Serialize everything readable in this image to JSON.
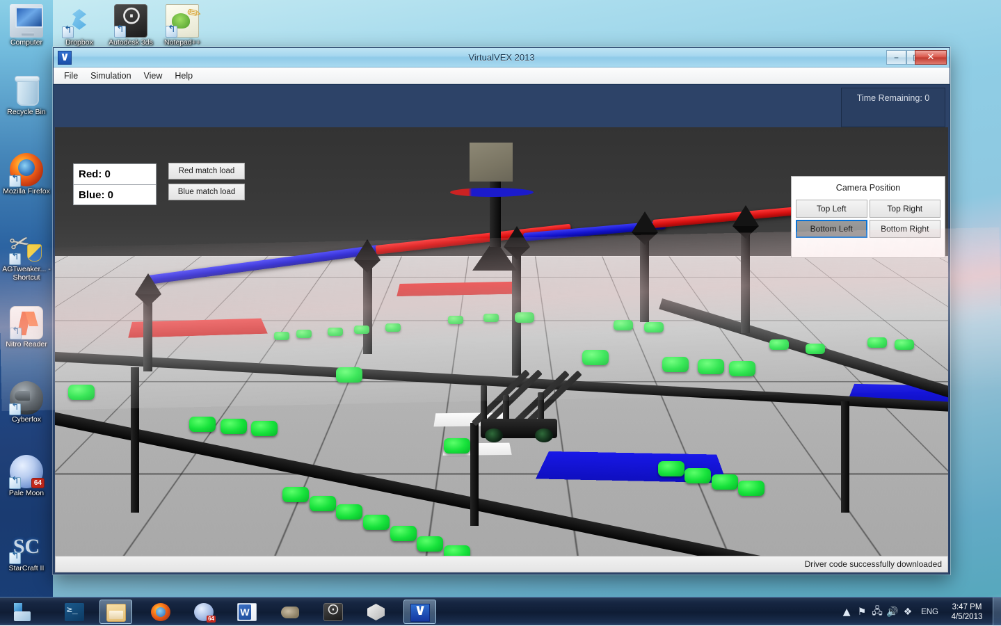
{
  "desktop": {
    "icons_left": [
      {
        "label": "Computer",
        "icon": "computer-icon"
      },
      {
        "label": "Recycle Bin",
        "icon": "recycle-bin-icon"
      },
      {
        "label": "Mozilla Firefox",
        "icon": "firefox-icon"
      },
      {
        "label": "AGTweaker... - Shortcut",
        "icon": "agtweaker-icon"
      },
      {
        "label": "Nitro Reader",
        "icon": "nitro-reader-icon"
      },
      {
        "label": "Cyberfox",
        "icon": "cyberfox-icon"
      },
      {
        "label": "Pale Moon",
        "icon": "pale-moon-icon",
        "badge": "64"
      },
      {
        "label": "StarCraft II",
        "icon": "starcraft-icon"
      }
    ],
    "icons_top": [
      {
        "label": "Dropbox",
        "icon": "dropbox-icon"
      },
      {
        "label": "Autodesk 3ds",
        "icon": "autodesk-3ds-icon"
      },
      {
        "label": "Notepad++",
        "icon": "notepad-plus-plus-icon"
      }
    ]
  },
  "window": {
    "title": "VirtualVEX 2013",
    "app_icon": "virtualvex-icon",
    "controls": {
      "minimize": "–",
      "maximize": "□",
      "close": "✕"
    },
    "menu": [
      "File",
      "Simulation",
      "View",
      "Help"
    ],
    "status": "Driver code successfully downloaded"
  },
  "hud": {
    "time_remaining": "Time Remaining: 0",
    "score": {
      "red": "Red: 0",
      "blue": "Blue: 0"
    },
    "match_load_buttons": [
      {
        "label": "Red match load",
        "name": "red-match-load-button"
      },
      {
        "label": "Blue match load",
        "name": "blue-match-load-button"
      }
    ],
    "camera": {
      "title": "Camera Position",
      "buttons": [
        {
          "label": "Top Left",
          "selected": false
        },
        {
          "label": "Top Right",
          "selected": false
        },
        {
          "label": "Bottom Left",
          "selected": true
        },
        {
          "label": "Bottom Right",
          "selected": false
        }
      ]
    }
  },
  "scene": {
    "description": "VEX Sack Attack 3D field viewport",
    "colors": {
      "red_trough": "#d81010",
      "blue_trough": "#1212cb",
      "sack_green": "#17e23b",
      "floor_gray": "#a6a6a6",
      "structure_black": "#0a0a0a",
      "background": "#3a3a3a"
    }
  },
  "taskbar": {
    "start_label": "Start",
    "items": [
      {
        "name": "taskbar-powershell",
        "icon": "powershell-icon"
      },
      {
        "name": "taskbar-explorer",
        "icon": "folder-icon",
        "active": false
      },
      {
        "name": "taskbar-firefox",
        "icon": "firefox-icon"
      },
      {
        "name": "taskbar-pale-moon",
        "icon": "pale-moon-icon",
        "badge": "64"
      },
      {
        "name": "taskbar-word",
        "icon": "word-icon"
      },
      {
        "name": "taskbar-gimp",
        "icon": "gimp-icon"
      },
      {
        "name": "taskbar-autodesk",
        "icon": "autodesk-3ds-icon"
      },
      {
        "name": "taskbar-unity",
        "icon": "unity-icon"
      },
      {
        "name": "taskbar-virtualvex",
        "icon": "virtualvex-icon",
        "active": true
      }
    ],
    "tray": {
      "show_hidden": "▲",
      "icons": [
        "flag-icon",
        "network-icon",
        "volume-icon",
        "dropbox-icon"
      ],
      "language": "ENG",
      "time": "3:47 PM",
      "date": "4/5/2013"
    }
  }
}
